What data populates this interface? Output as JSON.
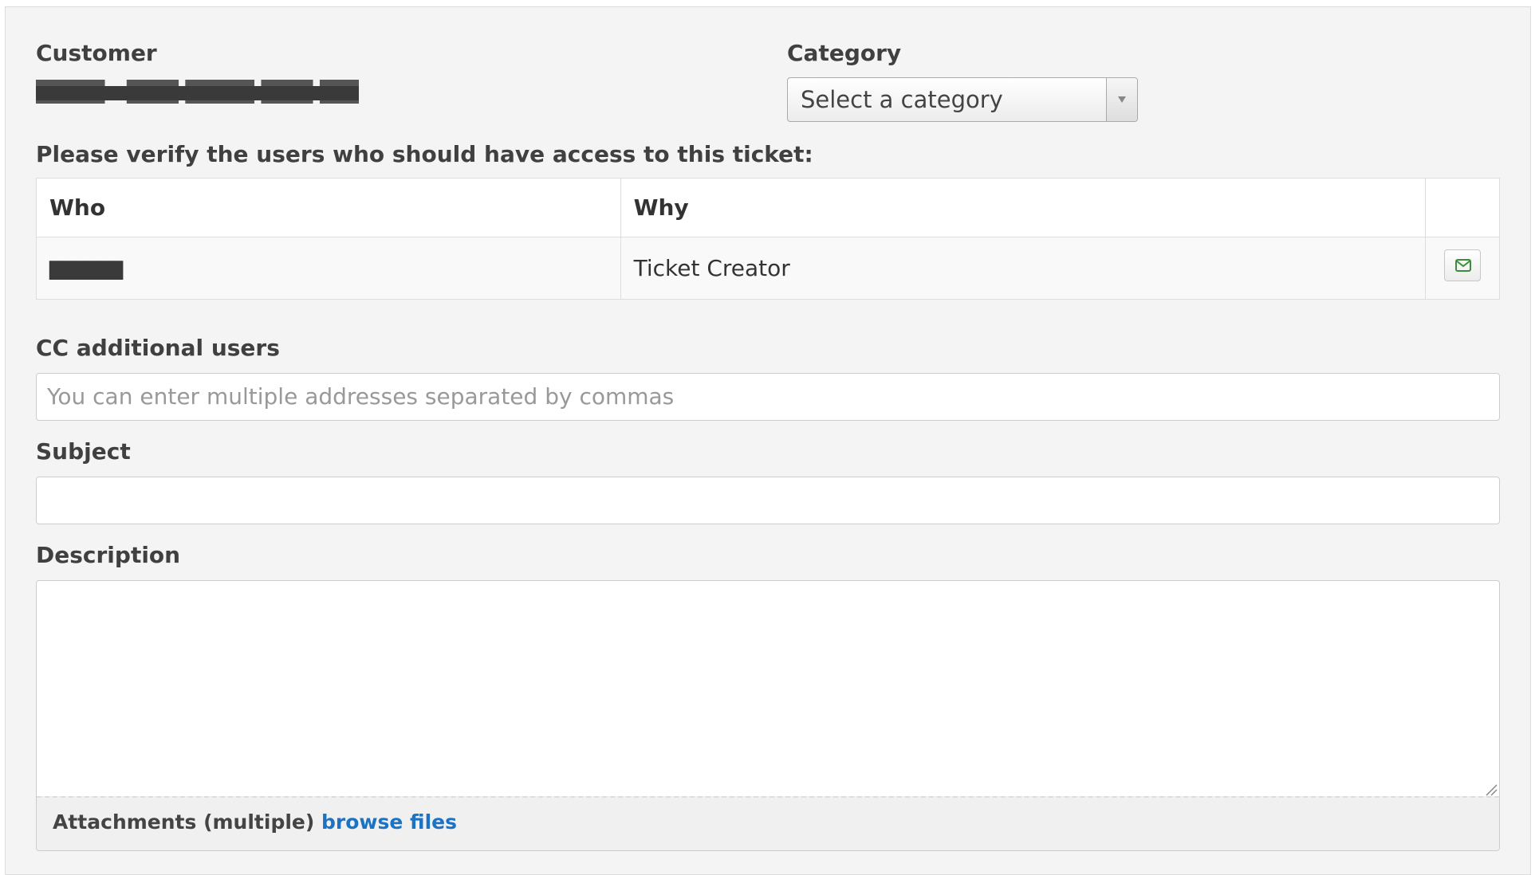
{
  "customer": {
    "label": "Customer",
    "value_redacted": "████ - ███ ████ ███ ███"
  },
  "category": {
    "label": "Category",
    "select_placeholder": "Select a category"
  },
  "access": {
    "heading": "Please verify the users who should have access to this ticket:",
    "columns": [
      "Who",
      "Why",
      ""
    ],
    "rows": [
      {
        "who_redacted": "██████",
        "why": "Ticket Creator",
        "action_icon": "envelope-icon"
      }
    ]
  },
  "cc": {
    "label": "CC additional users",
    "placeholder": "You can enter multiple addresses separated by commas"
  },
  "subject": {
    "label": "Subject",
    "value": ""
  },
  "description": {
    "label": "Description",
    "value": ""
  },
  "attachments": {
    "label": "Attachments (multiple)",
    "link": "browse files"
  },
  "colors": {
    "link": "#1a73c4",
    "mail_icon": "#3c8c3c"
  }
}
